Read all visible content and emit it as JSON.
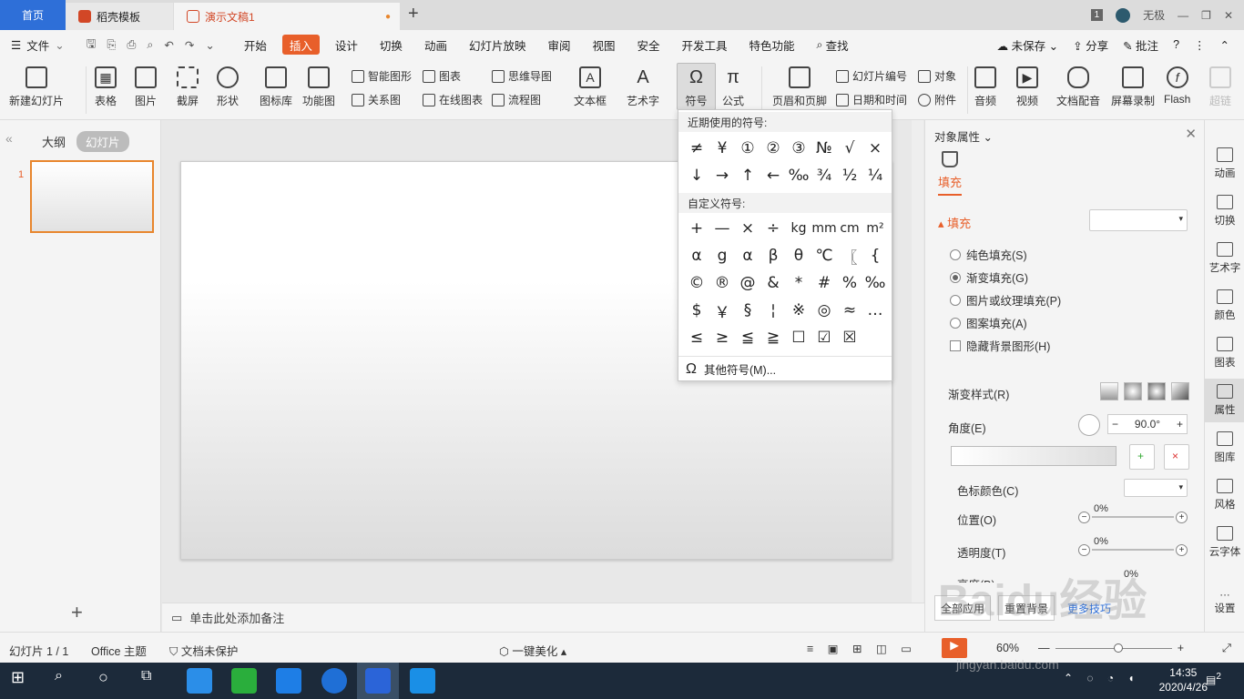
{
  "tabs": {
    "home": "首页",
    "daoke": "稻壳模板",
    "doc": "演示文稿1",
    "badge": "1",
    "user": "无极"
  },
  "menu": {
    "file": "文件",
    "items": [
      "开始",
      "插入",
      "设计",
      "切换",
      "动画",
      "幻灯片放映",
      "审阅",
      "视图",
      "安全",
      "开发工具",
      "特色功能"
    ],
    "search": "查找",
    "unsaved": "未保存",
    "share": "分享",
    "comment": "批注"
  },
  "ribbon": {
    "new_slide": "新建幻灯片",
    "table": "表格",
    "picture": "图片",
    "screenshot": "截屏",
    "shape": "形状",
    "icon_lib": "图标库",
    "func_chart": "功能图",
    "smart_art": "智能图形",
    "chart": "图表",
    "relation": "关系图",
    "online_chart": "在线图表",
    "mindmap": "思维导图",
    "flowchart": "流程图",
    "textbox": "文本框",
    "wordart": "艺术字",
    "symbol": "符号",
    "formula": "公式",
    "header_footer": "页眉和页脚",
    "slide_number": "幻灯片编号",
    "object": "对象",
    "datetime": "日期和时间",
    "attachment": "附件",
    "audio": "音频",
    "video": "视频",
    "doc_dub": "文档配音",
    "screen_rec": "屏幕录制",
    "flash": "Flash",
    "hyperlink": "超链"
  },
  "left_panel": {
    "outline": "大纲",
    "slides": "幻灯片",
    "slide_number": "1"
  },
  "notes": "单击此处添加备注",
  "symbol_dropdown": {
    "recent_title": "近期使用的符号:",
    "recent": [
      "≠",
      "¥",
      "①",
      "②",
      "③",
      "№",
      "√",
      "×",
      "↓",
      "→",
      "↑",
      "←",
      "‰",
      "¾",
      "½",
      "¼"
    ],
    "custom_title": "自定义符号:",
    "custom": [
      "+",
      "—",
      "×",
      "÷",
      "kg",
      "mm",
      "cm",
      "m²",
      "α",
      "g",
      "α",
      "β",
      "θ",
      "℃",
      "〖",
      "{",
      "©",
      "®",
      "@",
      "&",
      "*",
      "#",
      "%",
      "‰",
      "$",
      "￥",
      "§",
      "¦",
      "※",
      "◎",
      "≈",
      "…",
      "≤",
      "≥",
      "≦",
      "≧",
      "☐",
      "☑",
      "☒"
    ],
    "more": "其他符号(M)..."
  },
  "properties": {
    "title": "对象属性",
    "fill_tab": "填充",
    "fill_section": "填充",
    "options": [
      "纯色填充(S)",
      "渐变填充(G)",
      "图片或纹理填充(P)",
      "图案填充(A)"
    ],
    "selected_option": 1,
    "hide_bg": "隐藏背景图形(H)",
    "gradient_style": "渐变样式(R)",
    "angle_label": "角度(E)",
    "angle_value": "90.0°",
    "stop_color": "色标颜色(C)",
    "position_label": "位置(O)",
    "position_value": "0%",
    "transparency_label": "透明度(T)",
    "transparency_value": "0%",
    "brightness_label": "亮度(B)",
    "brightness_value": "0%",
    "apply_all": "全部应用",
    "reset": "重置背景",
    "more_fonts": "更多技巧"
  },
  "sidebar": [
    "动画",
    "切换",
    "艺术字",
    "颜色",
    "图表",
    "属性",
    "图库",
    "风格",
    "云字体",
    "设置"
  ],
  "status": {
    "slide_info": "幻灯片 1 / 1",
    "theme": "Office 主题",
    "protect": "文档未保护",
    "beautify": "一键美化",
    "zoom": "60%"
  },
  "taskbar": {
    "time": "14:35",
    "date": "2020/4/26",
    "notif": "2"
  },
  "watermark": {
    "logo": "Baidu经验",
    "url": "jingyan.baidu.com"
  },
  "colors": {
    "accent": "#e85f2a",
    "home_tab": "#2e6fd8",
    "taskbar": "#1c2a3a"
  }
}
